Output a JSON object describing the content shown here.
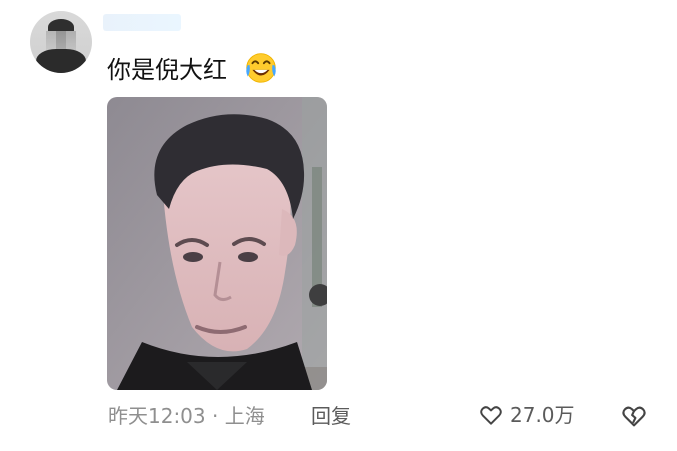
{
  "comment": {
    "text": "你是倪大红",
    "emoji": "laughing-with-tears-emoji"
  },
  "meta": {
    "time": "昨天12:03",
    "separator": "·",
    "location": "上海",
    "reply_label": "回复"
  },
  "actions": {
    "like_count": "27.0万",
    "like_icon": "heart-outline-icon",
    "dislike_icon": "broken-heart-icon"
  },
  "colors": {
    "meta_text": "#8f8f8f",
    "action_text": "#5b5b5b",
    "comment_text": "#111111"
  }
}
